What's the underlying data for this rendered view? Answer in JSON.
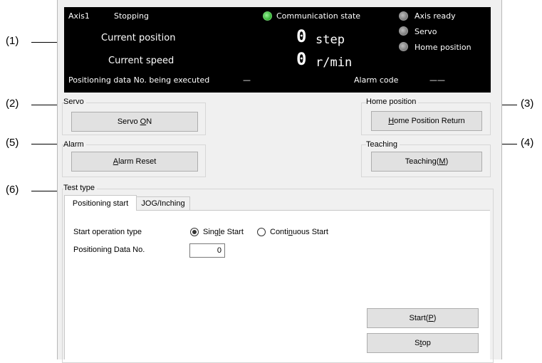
{
  "callouts": [
    "(1)",
    "(2)",
    "(3)",
    "(4)",
    "(5)",
    "(6)"
  ],
  "status": {
    "axis": "Axis1",
    "state": "Stopping",
    "communication_label": "Communication state",
    "communication_color": "#2fae2f",
    "current_position_label": "Current position",
    "current_position_value": "0",
    "current_position_unit": "step",
    "current_speed_label": "Current speed",
    "current_speed_value": "0",
    "current_speed_unit": "r/min",
    "executing_label": "Positioning data No. being executed",
    "executing_value": "—",
    "alarm_code_label": "Alarm code",
    "alarm_code_value": "——",
    "indicators": [
      "Axis ready",
      "Servo",
      "Home position"
    ]
  },
  "servo": {
    "group_label": "Servo",
    "button_pre": "Servo ",
    "button_key": "O",
    "button_post": "N"
  },
  "home": {
    "group_label": "Home position",
    "button_key": "H",
    "button_post": "ome Position Return"
  },
  "alarm": {
    "group_label": "Alarm",
    "button_key": "A",
    "button_post": "larm Reset"
  },
  "teaching": {
    "group_label": "Teaching",
    "button_pre": "Teaching(",
    "button_key": "M",
    "button_post": ")"
  },
  "test": {
    "group_label": "Test type",
    "tabs": [
      "Positioning start",
      "JOG/Inching"
    ],
    "start_operation_label": "Start operation type",
    "single_pre": "Sing",
    "single_key": "l",
    "single_post": "e Start",
    "continuous_pre": "Conti",
    "continuous_key": "n",
    "continuous_post": "uous Start",
    "positioning_pre": "Positionin",
    "positioning_key": "g",
    "positioning_post": " Data No.",
    "positioning_value": "0",
    "start_pre": "Start(",
    "start_key": "P",
    "start_post": ")",
    "stop_pre": "S",
    "stop_key": "t",
    "stop_post": "op"
  }
}
